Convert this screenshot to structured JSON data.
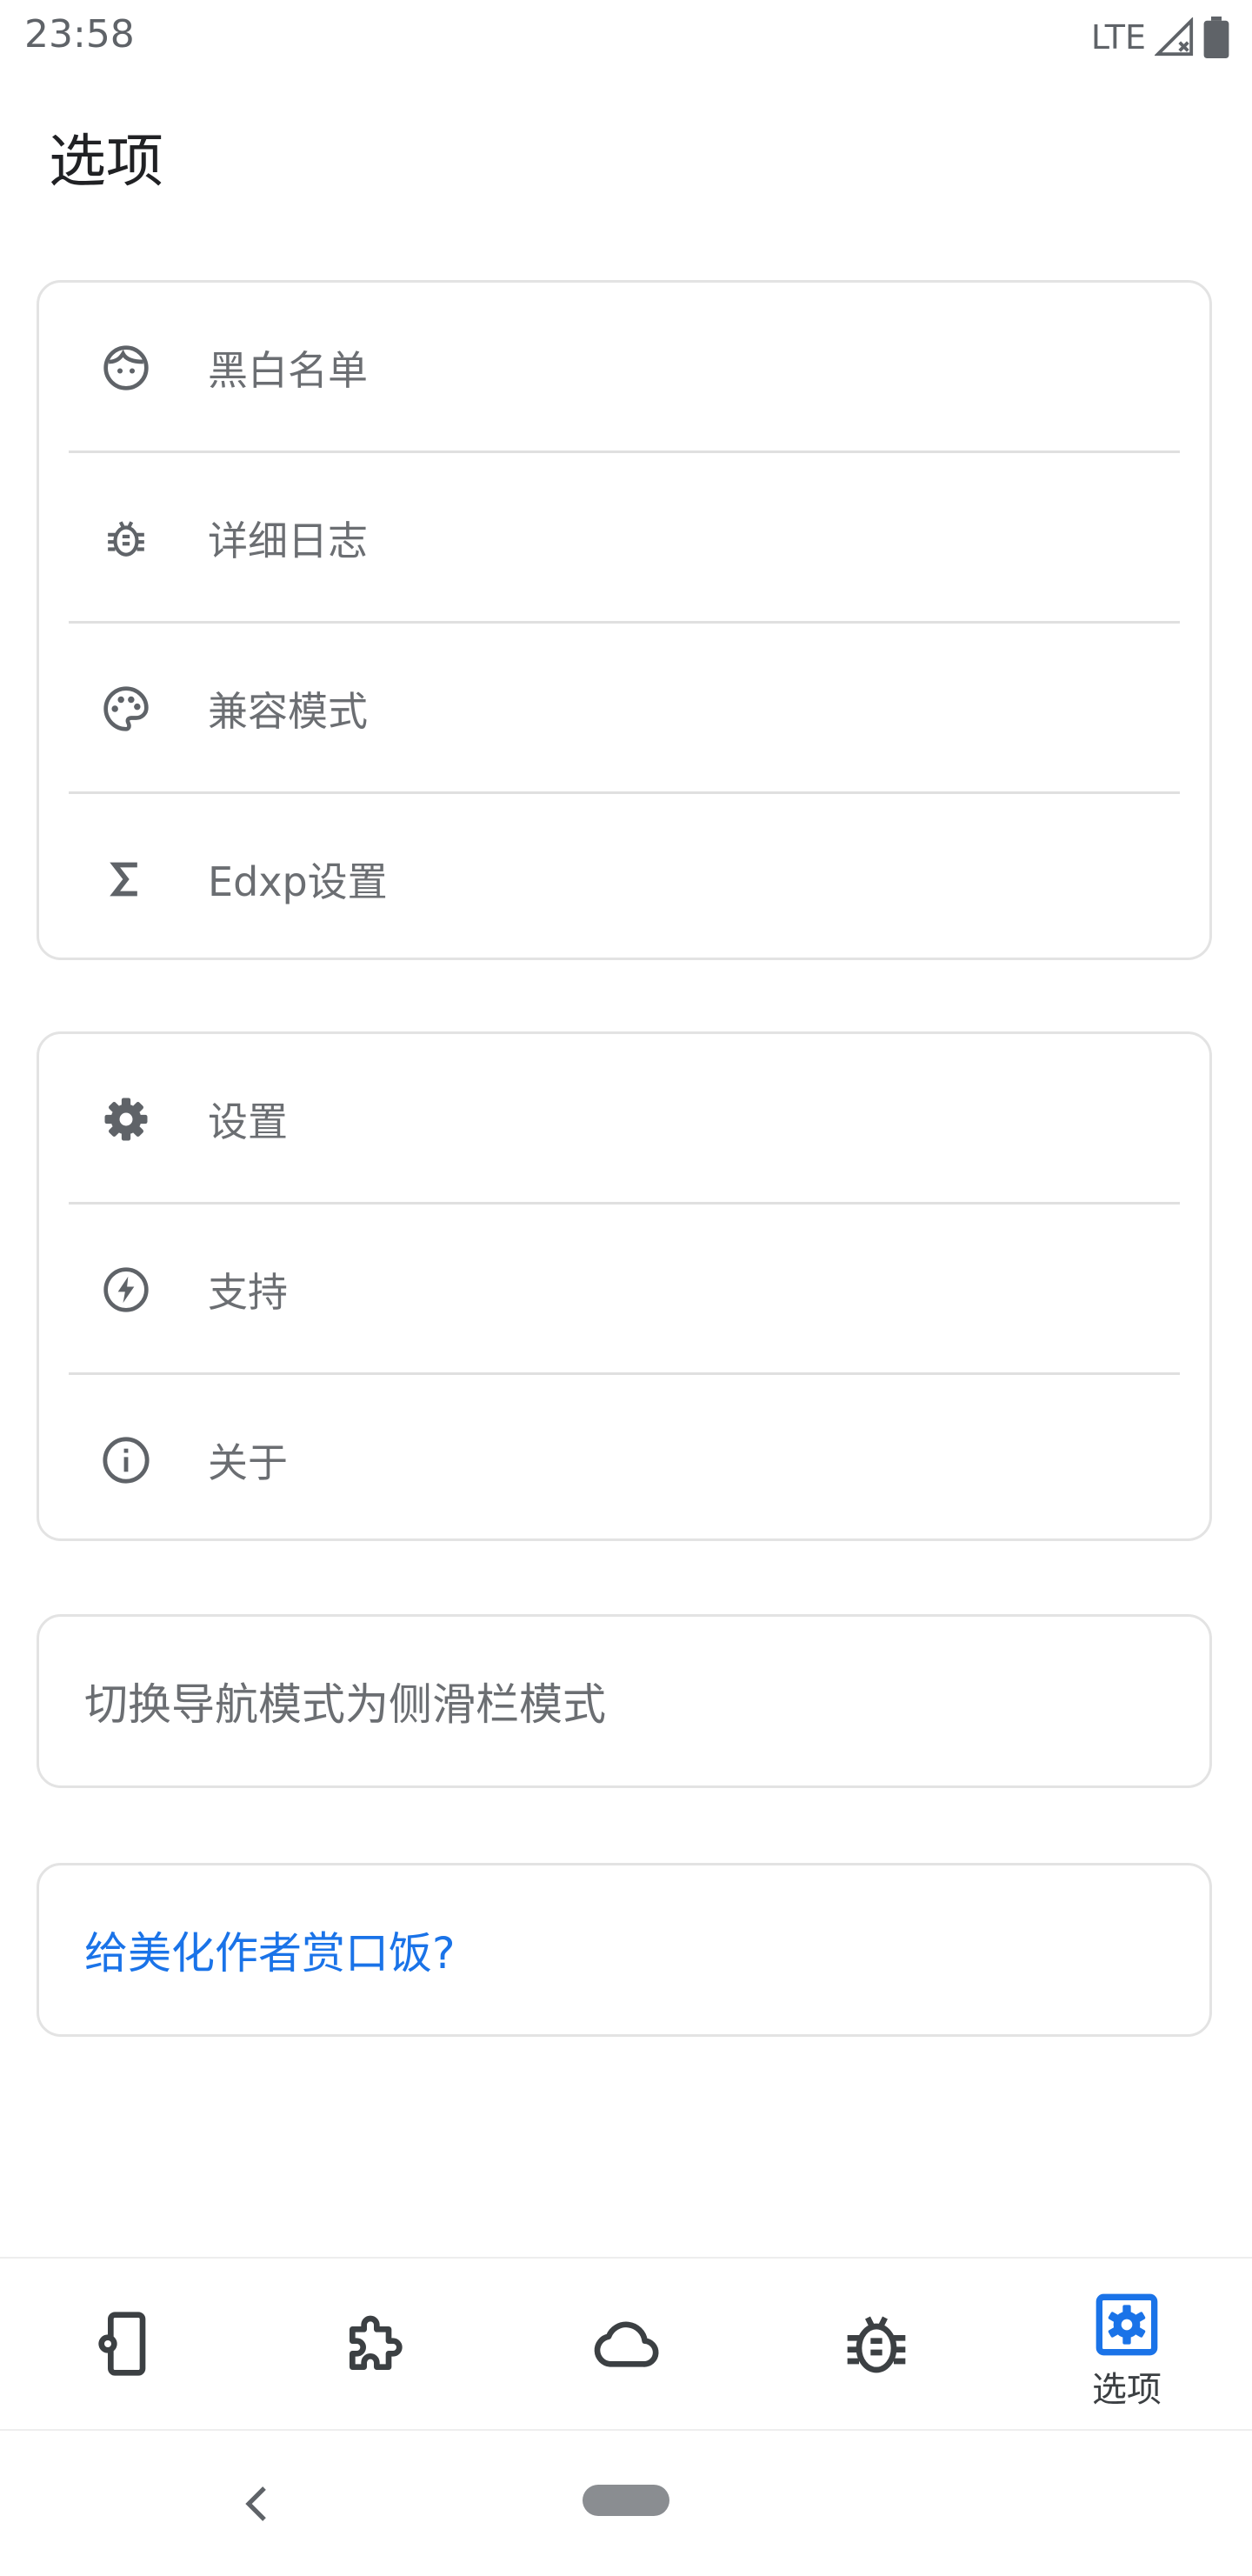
{
  "status_bar": {
    "time": "23:58",
    "network": "LTE"
  },
  "page": {
    "title": "选项"
  },
  "group1": [
    {
      "label": "黑白名单",
      "icon": "face-icon"
    },
    {
      "label": "详细日志",
      "icon": "bug-icon"
    },
    {
      "label": "兼容模式",
      "icon": "palette-icon"
    },
    {
      "label": "Edxp设置",
      "icon": "sigma-icon"
    }
  ],
  "group2": [
    {
      "label": "设置",
      "icon": "gear-icon"
    },
    {
      "label": "支持",
      "icon": "bolt-icon"
    },
    {
      "label": "关于",
      "icon": "info-icon"
    }
  ],
  "nav_mode": {
    "label": "切换导航模式为侧滑栏模式"
  },
  "donate": {
    "label": "给美化作者赏口饭?"
  },
  "bottom_nav": {
    "items": [
      {
        "icon": "phone-settings-icon",
        "label": ""
      },
      {
        "icon": "puzzle-icon",
        "label": ""
      },
      {
        "icon": "cloud-icon",
        "label": ""
      },
      {
        "icon": "bug-icon",
        "label": ""
      },
      {
        "icon": "settings-box-icon",
        "label": "选项",
        "active": true
      }
    ]
  },
  "colors": {
    "accent": "#1a73e8",
    "icon": "#5f6368",
    "text_secondary": "#6b6e72",
    "border": "#e3e3e3"
  }
}
